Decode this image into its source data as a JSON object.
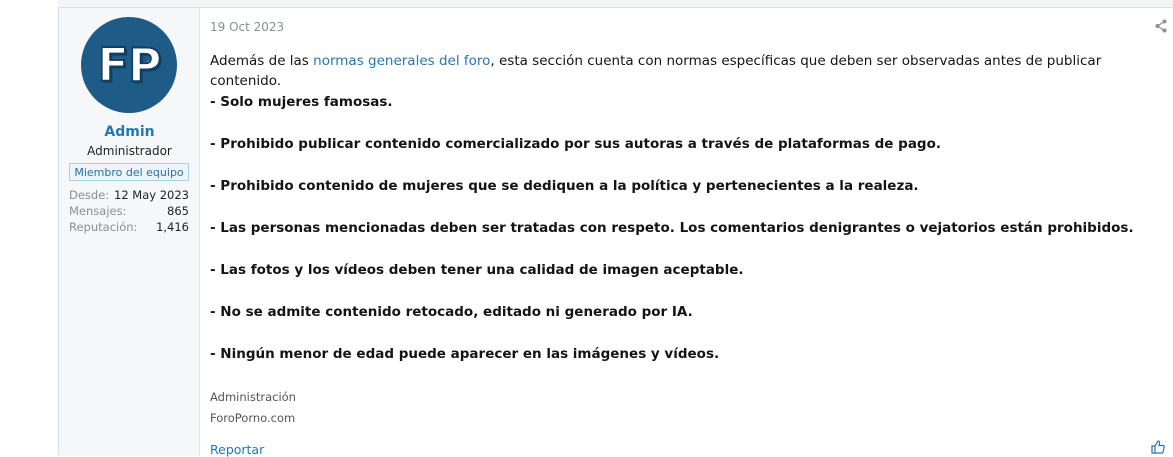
{
  "user": {
    "avatar_initials": "FP",
    "name": "Admin",
    "title": "Administrador",
    "badge": "Miembro del equipo",
    "stats": [
      {
        "key": "Desde:",
        "value": "12 May 2023"
      },
      {
        "key": "Mensajes:",
        "value": "865"
      },
      {
        "key": "Reputación:",
        "value": "1,416"
      }
    ]
  },
  "post": {
    "date": "19 Oct 2023",
    "intro_before": "Además de las ",
    "intro_link": "normas generales del foro",
    "intro_after": ", esta sección cuenta con normas específicas que deben ser observadas antes de publicar contenido.",
    "rules": [
      "- Solo mujeres famosas.",
      "- Prohibido publicar contenido comercializado por sus autoras a través de plataformas de pago.",
      "- Prohibido contenido de mujeres que se dediquen a la política y pertenecientes a la realeza.",
      "- Las personas mencionadas deben ser tratadas con respeto. Los comentarios denigrantes o vejatorios están prohibidos.",
      "- Las fotos y los vídeos deben tener una calidad de imagen aceptable.",
      "- No se admite contenido retocado, editado ni generado por IA.",
      "- Ningún menor de edad puede aparecer en las imágenes y vídeos."
    ],
    "signature": [
      "Administración",
      "ForoPorno.com"
    ],
    "report_label": "Reportar"
  },
  "icons": {
    "share": "share-icon",
    "like": "thumbs-up-icon"
  },
  "colors": {
    "link": "#2577b1",
    "avatar_bg": "#1e5b86",
    "user_col_bg": "#f5f7f9"
  }
}
